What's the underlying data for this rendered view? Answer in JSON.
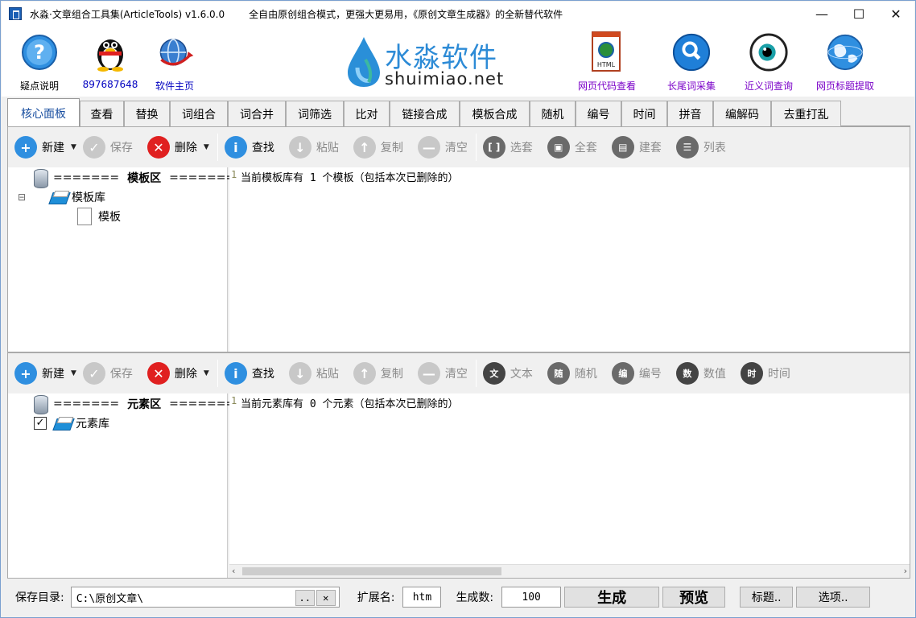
{
  "window": {
    "title": "水淼·文章组合工具集(ArticleTools) v1.6.0.0",
    "subtitle": "全自由原创组合模式，更强大更易用，《原创文章生成器》的全新替代软件",
    "controls": [
      "—",
      "☐",
      "✕"
    ]
  },
  "header": {
    "tools_left": [
      {
        "label": "疑点说明",
        "icon": "help-icon",
        "color": "#000000"
      },
      {
        "label": "897687648",
        "icon": "qq-penguin-icon",
        "color": "#0000c0"
      },
      {
        "label": "软件主页",
        "icon": "globe-home-icon",
        "color": "#0000c0"
      }
    ],
    "logo": {
      "cn": "水淼软件",
      "en": "shuimiao.net"
    },
    "tools_right": [
      {
        "label": "网页代码查看",
        "icon": "html-file-icon",
        "color": "#7a00c8"
      },
      {
        "label": "长尾词采集",
        "icon": "magnifier-icon",
        "color": "#7a00c8"
      },
      {
        "label": "近义词查询",
        "icon": "eye-icon",
        "color": "#7a00c8"
      },
      {
        "label": "网页标题提取",
        "icon": "globe-icon",
        "color": "#7a00c8"
      }
    ]
  },
  "tabs": [
    "核心面板",
    "查看",
    "替换",
    "词组合",
    "词合并",
    "词筛选",
    "比对",
    "链接合成",
    "模板合成",
    "随机",
    "编号",
    "时间",
    "拼音",
    "编解码",
    "去重打乱"
  ],
  "active_tab": "核心面板",
  "template_panel": {
    "toolbar": {
      "new": "新建",
      "save": "保存",
      "delete": "删除",
      "find": "查找",
      "paste": "粘贴",
      "copy": "复制",
      "clear": "清空",
      "select_set": "选套",
      "all_set": "全套",
      "build_set": "建套",
      "list": "列表"
    },
    "tree": {
      "header_prefix": "=======",
      "header": "模板区",
      "header_suffix": "=======",
      "library": "模板库",
      "item": "模板",
      "expander": "⊟"
    },
    "editor": {
      "line": "1",
      "text": "当前模板库有 1 个模板（包括本次已删除的）"
    }
  },
  "element_panel": {
    "toolbar": {
      "new": "新建",
      "save": "保存",
      "delete": "删除",
      "find": "查找",
      "paste": "粘贴",
      "copy": "复制",
      "clear": "清空",
      "text": "文本",
      "random": "随机",
      "number": "编号",
      "value": "数值",
      "time": "时间"
    },
    "tree": {
      "header_prefix": "=======",
      "header": "元素区",
      "header_suffix": "=======",
      "library": "元素库",
      "check": "✓"
    },
    "editor": {
      "line": "1",
      "text": "当前元素库有 0 个元素（包括本次已删除的）"
    }
  },
  "footer": {
    "save_dir_label": "保存目录:",
    "save_dir_value": "C:\\原创文章\\",
    "browse": "..",
    "clear": "✕",
    "ext_label": "扩展名:",
    "ext_value": "htm",
    "count_label": "生成数:",
    "count_value": "100",
    "generate": "生成",
    "preview": "预览",
    "title_btn": "标题..",
    "options_btn": "选项.."
  }
}
